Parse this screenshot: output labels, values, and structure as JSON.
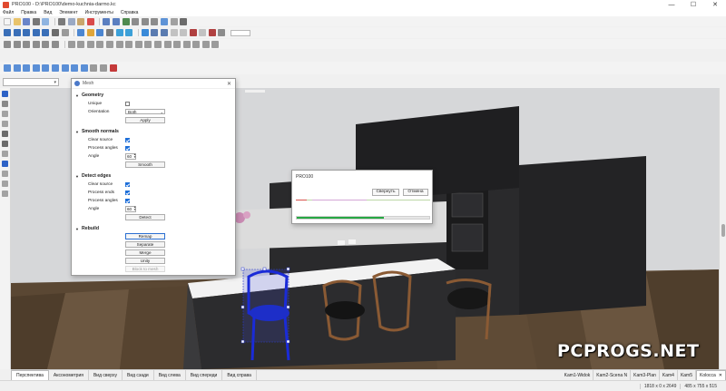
{
  "window": {
    "title": "PRO100 - D:\\PRO100\\demo-kuchnia-darmo.kc",
    "controls": {
      "minimize": "—",
      "maximize": "☐",
      "close": "✕"
    }
  },
  "menu": [
    "Файл",
    "Правка",
    "Вид",
    "Элемент",
    "Инструменты",
    "Справка"
  ],
  "toolbar": {
    "zoom_value": "",
    "layer_value": ""
  },
  "mesh_dialog": {
    "title": "Mesh",
    "close_glyph": "✕",
    "geometry": {
      "header": "Geometry",
      "unique_label": "Unique",
      "unique_checked": false,
      "orientation_label": "Orientation",
      "orientation_value": "Both",
      "apply_label": "Apply"
    },
    "smooth_normals": {
      "header": "Smooth normals",
      "clear_source_label": "Clear source",
      "clear_source_checked": true,
      "process_angles_label": "Process angles",
      "process_angles_checked": true,
      "angle_label": "Angle",
      "angle_value": "60",
      "smooth_label": "Smooth"
    },
    "detect_edges": {
      "header": "Detect edges",
      "clear_source_label": "Clear source",
      "clear_source_checked": true,
      "process_ends_label": "Process ends",
      "process_ends_checked": true,
      "process_angles_label": "Process angles",
      "process_angles_checked": true,
      "angle_label": "Angle",
      "angle_value": "60",
      "detect_label": "Detect"
    },
    "rebuild": {
      "header": "Rebuild",
      "remap_label": "Remap",
      "separate_label": "Separate",
      "merge_label": "Merge",
      "unity_label": "Unity",
      "block_to_mesh_label": "Block to mesh"
    }
  },
  "progress_dialog": {
    "title": "PRO100",
    "minimize_label": "Свернуть",
    "cancel_label": "Отмена",
    "progress": 0.66
  },
  "view_tabs": [
    "Перспектива",
    "Аксонометрия",
    "Вид сверху",
    "Вид сзади",
    "Вид слева",
    "Вид спереди",
    "Вид справа"
  ],
  "camera_tabs": [
    "Kam1-Widok",
    "Kam2-Scena N",
    "Kam3-Plan",
    "Kam4",
    "Kam5",
    "Kolocca"
  ],
  "camera_tab_close": "✕",
  "status": {
    "dimensions": "1818 x 0 x 2649",
    "viewport_size": "485 x 755 x 515"
  },
  "watermark": "PCPROGS.NET",
  "colors": {
    "accent": "#1e6fd9",
    "progress_fill": "#27a844",
    "selection": "#1a2bd8"
  }
}
